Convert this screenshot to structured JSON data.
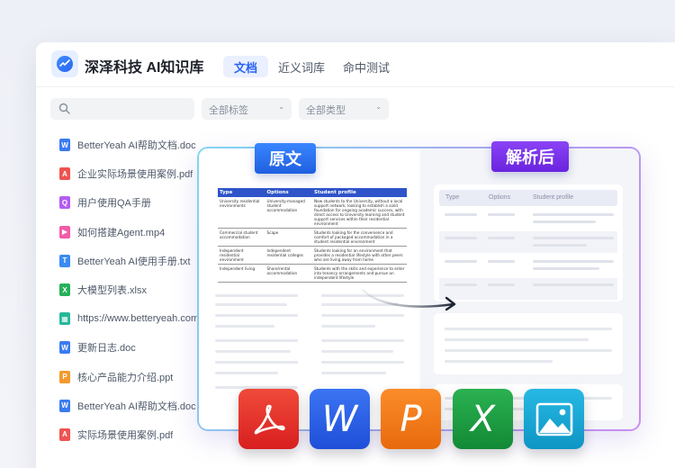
{
  "app": {
    "title": "深泽科技 AI知识库",
    "tabs": [
      {
        "label": "文档",
        "active": true
      },
      {
        "label": "近义词库",
        "active": false
      },
      {
        "label": "命中测试",
        "active": false
      }
    ]
  },
  "filters": {
    "search_placeholder": "",
    "tag_select": "全部标签",
    "type_select": "全部类型"
  },
  "files": [
    {
      "name": "BetterYeah AI帮助文档.doc",
      "icon": "word-icon",
      "color": "#3a7bf2",
      "glyph": "W"
    },
    {
      "name": "企业实际场景使用案例.pdf",
      "icon": "pdf-icon",
      "color": "#ef5350",
      "glyph": "A"
    },
    {
      "name": "用户使用QA手册",
      "icon": "qa-icon",
      "color": "#b35cf0",
      "glyph": "Q"
    },
    {
      "name": "如何搭建Agent.mp4",
      "icon": "video-icon",
      "color": "#f25ba8",
      "glyph": "▶"
    },
    {
      "name": "BetterYeah AI使用手册.txt",
      "icon": "text-icon",
      "color": "#3a8bf2",
      "glyph": "T"
    },
    {
      "name": "大模型列表.xlsx",
      "icon": "excel-icon",
      "color": "#27b05a",
      "glyph": "X"
    },
    {
      "name": "https://www.betteryeah.com",
      "icon": "web-icon",
      "color": "#26b89a",
      "glyph": "▦"
    },
    {
      "name": "更新日志.doc",
      "icon": "word-icon",
      "color": "#3a7bf2",
      "glyph": "W"
    },
    {
      "name": "核心产品能力介绍.ppt",
      "icon": "ppt-icon",
      "color": "#f29a2e",
      "glyph": "P"
    },
    {
      "name": "BetterYeah AI帮助文档.doc",
      "icon": "word-icon",
      "color": "#3a7bf2",
      "glyph": "W"
    },
    {
      "name": "实际场景使用案例.pdf",
      "icon": "pdf-icon",
      "color": "#ef5350",
      "glyph": "A"
    }
  ],
  "compare": {
    "original_label": "原文",
    "parsed_label": "解析后",
    "original_table": {
      "headers": [
        "Type",
        "Options",
        "Student profile"
      ],
      "rows": [
        [
          "University residential environments",
          "University-managed student accommodation",
          "New students to the University, without a local support network, looking to establish a solid foundation for ongoing academic success, with direct access to University learning and student support services within their residential environment"
        ],
        [
          "Commercial student accommodation",
          "Scape",
          "Students looking for the convenience and comfort of packaged accommodation in a student residential environment"
        ],
        [
          "Independent residential environment",
          "Independent residential colleges",
          "Students looking for an environment that provides a residential lifestyle with other peers who are living away from home"
        ],
        [
          "Independent living",
          "Share/rental accommodation",
          "Students with the skills and experience to enter into tenancy arrangements and pursue an independent lifestyle"
        ]
      ]
    },
    "parsed_headers": [
      "Type",
      "Options",
      "Student profile"
    ]
  },
  "format_icons": [
    {
      "name": "pdf-format-icon",
      "color": "#e8322f",
      "glyph": "acrobat"
    },
    {
      "name": "word-format-icon",
      "color": "#2f62ea",
      "glyph": "W"
    },
    {
      "name": "ppt-format-icon",
      "color": "#f07a18",
      "glyph": "P"
    },
    {
      "name": "excel-format-icon",
      "color": "#1f9e3e",
      "glyph": "X"
    },
    {
      "name": "image-format-icon",
      "color": "#17a9d6",
      "glyph": "image"
    }
  ]
}
